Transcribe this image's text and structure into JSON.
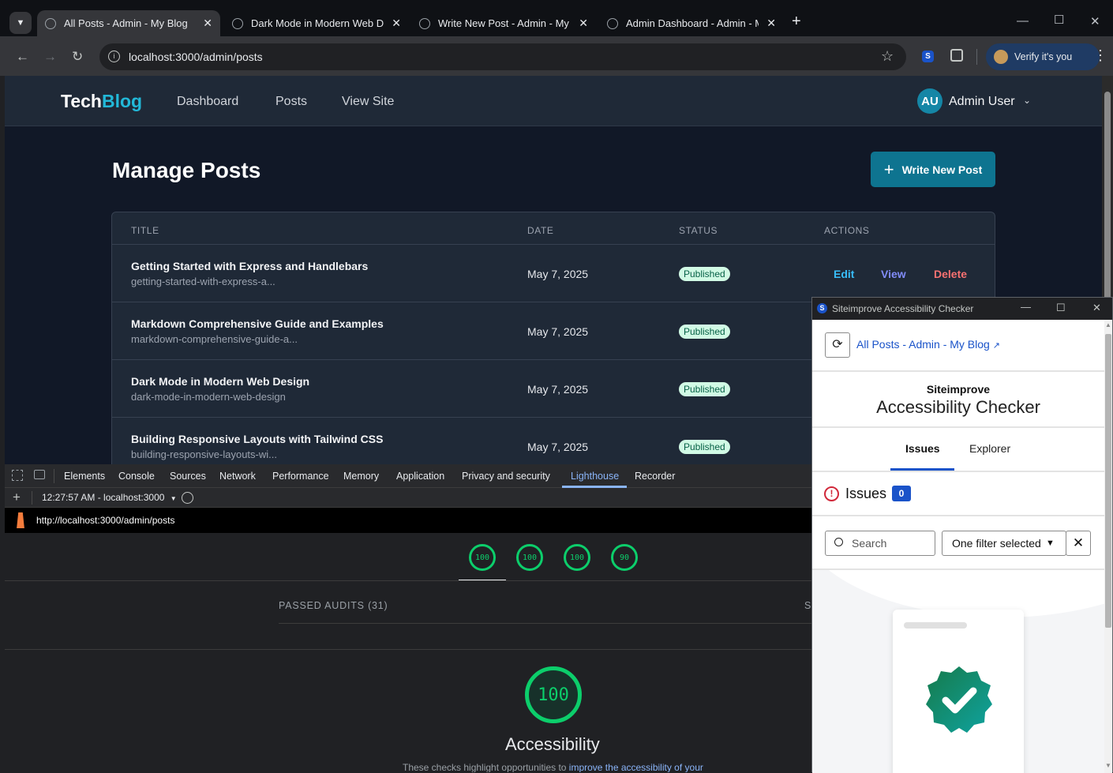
{
  "browser": {
    "tabs": [
      {
        "label": "All Posts - Admin - My Blog",
        "active": true
      },
      {
        "label": "Dark Mode in Modern Web Design - My Blog",
        "active": false
      },
      {
        "label": "Write New Post - Admin - My Blog",
        "active": false
      },
      {
        "label": "Admin Dashboard - Admin - My Blog",
        "active": false
      }
    ],
    "url": "localhost:3000/admin/posts",
    "verify_label": "Verify it's you"
  },
  "site": {
    "logo_part1": "Tech",
    "logo_part2": "Blog",
    "nav": [
      "Dashboard",
      "Posts",
      "View Site"
    ],
    "user_initials": "AU",
    "user_name": "Admin User",
    "page_title": "Manage Posts",
    "new_post_label": "Write New Post",
    "columns": [
      "TITLE",
      "DATE",
      "STATUS",
      "ACTIONS"
    ],
    "actions": {
      "edit": "Edit",
      "view": "View",
      "delete": "Delete"
    },
    "posts": [
      {
        "title": "Getting Started with Express and Handlebars",
        "slug": "getting-started-with-express-a...",
        "date": "May 7, 2025",
        "status": "Published"
      },
      {
        "title": "Markdown Comprehensive Guide and Examples",
        "slug": "markdown-comprehensive-guide-a...",
        "date": "May 7, 2025",
        "status": "Published"
      },
      {
        "title": "Dark Mode in Modern Web Design",
        "slug": "dark-mode-in-modern-web-design",
        "date": "May 7, 2025",
        "status": "Published"
      },
      {
        "title": "Building Responsive Layouts with Tailwind CSS",
        "slug": "building-responsive-layouts-wi...",
        "date": "May 7, 2025",
        "status": "Published"
      }
    ]
  },
  "devtools": {
    "tabs": [
      "Elements",
      "Console",
      "Sources",
      "Network",
      "Performance",
      "Memory",
      "Application",
      "Privacy and security",
      "Lighthouse",
      "Recorder"
    ],
    "active_tab": "Lighthouse",
    "report_select": "12:27:57 AM - localhost:3000",
    "report_url": "http://localhost:3000/admin/posts",
    "scores": [
      "100",
      "100",
      "100",
      "90"
    ],
    "passed_audits": "PASSED AUDITS (31)",
    "right_cut": "S",
    "big_score": "100",
    "category": "Accessibility",
    "desc_text": "These checks highlight opportunities to ",
    "desc_link": "improve the accessibility of your"
  },
  "siteimprove": {
    "window_title": "Siteimprove Accessibility Checker",
    "page_link": "All Posts - Admin - My Blog",
    "brand": "Siteimprove",
    "product": "Accessibility Checker",
    "tabs": [
      "Issues",
      "Explorer"
    ],
    "issues_label": "Issues",
    "issues_count": "0",
    "search_placeholder": "Search",
    "filter_label": "One filter selected"
  }
}
